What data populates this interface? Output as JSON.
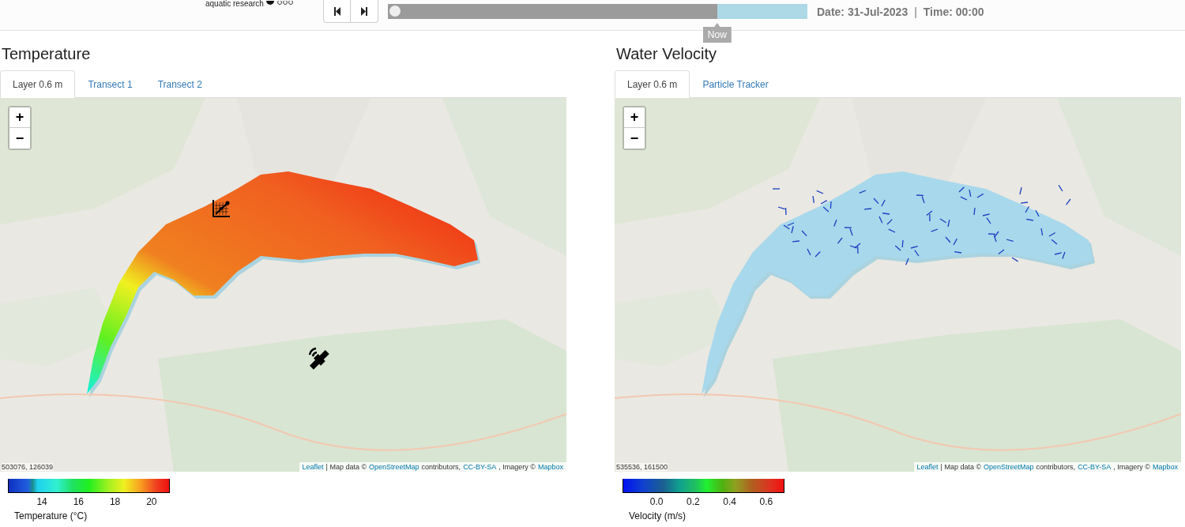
{
  "header": {
    "logo_text": "aquatic research",
    "buttons": [
      {
        "kind": "back"
      },
      {
        "kind": "forward"
      }
    ],
    "timeline": {
      "level": 0.785,
      "marker": "Now"
    },
    "date": "Date: 31-Jul-2023",
    "separator": "|",
    "time": "Time: 00:00"
  },
  "panels": [
    {
      "title": "Temperature",
      "kind": "temperature",
      "tabs": [
        {
          "label": "Layer 0.6 m",
          "selected": true
        },
        {
          "label": "Transect 1",
          "selected": false
        },
        {
          "label": "Transect 2",
          "selected": false
        }
      ],
      "zoom": [
        "+",
        "−"
      ],
      "coords": "503076, 126039",
      "attribution": [
        {
          "text": "Leaflet",
          "kind": "link"
        },
        {
          "text": "| Map data ©",
          "kind": "text"
        },
        {
          "text": "OpenStreetMap",
          "kind": "link"
        },
        {
          "text": "contributors,",
          "kind": "text"
        },
        {
          "text": "CC-BY-SA",
          "kind": "link"
        },
        {
          "text": ", Imagery ©",
          "kind": "text"
        },
        {
          "text": "Mapbox",
          "kind": "link"
        }
      ],
      "legend": {
        "ticks": [
          "14",
          "16",
          "18",
          "20"
        ],
        "label": "Temperature (°C)"
      }
    },
    {
      "title": "Water Velocity",
      "kind": "velocity",
      "tabs": [
        {
          "label": "Layer 0.6 m",
          "selected": true
        },
        {
          "label": "Particle Tracker",
          "selected": false
        }
      ],
      "zoom": [
        "+",
        "−"
      ],
      "coords": "535536, 161500",
      "attribution": [
        {
          "text": "Leaflet",
          "kind": "link"
        },
        {
          "text": "| Map data ©",
          "kind": "text"
        },
        {
          "text": "OpenStreetMap",
          "kind": "link"
        },
        {
          "text": "contributors,",
          "kind": "text"
        },
        {
          "text": "CC-BY-SA",
          "kind": "link"
        },
        {
          "text": ", Imagery ©",
          "kind": "text"
        },
        {
          "text": "Mapbox",
          "kind": "link"
        }
      ],
      "legend": {
        "ticks": [
          "0.0",
          "0.2",
          "0.4",
          "0.6"
        ],
        "label": "Velocity (m/s)"
      }
    }
  ]
}
